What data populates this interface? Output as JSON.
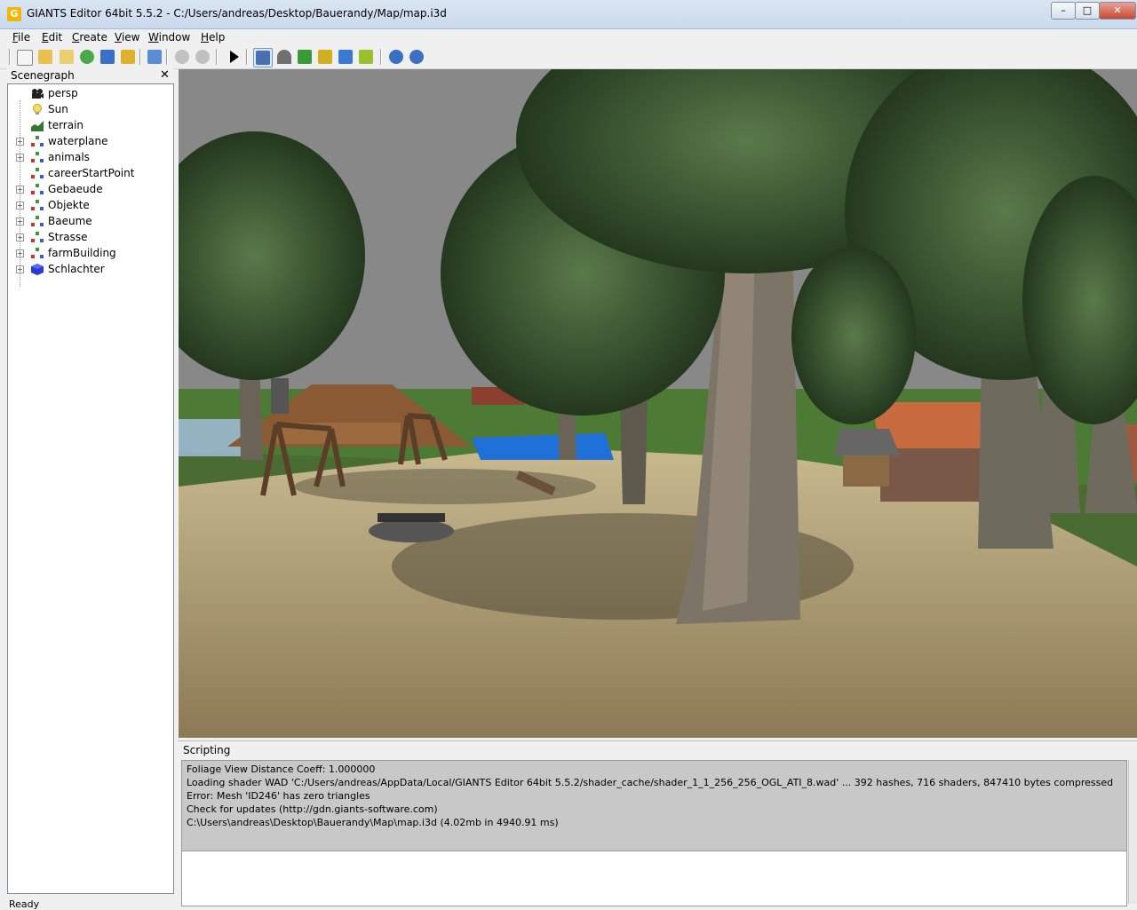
{
  "window": {
    "title": "GIANTS Editor 64bit 5.5.2 - C:/Users/andreas/Desktop/Bauerandy/Map/map.i3d",
    "app_icon_letter": "G",
    "minimize": "–",
    "maximize": "□",
    "close": "✕"
  },
  "menu": {
    "items": [
      {
        "label": "File"
      },
      {
        "label": "Edit"
      },
      {
        "label": "Create"
      },
      {
        "label": "View"
      },
      {
        "label": "Window"
      },
      {
        "label": "Help"
      }
    ]
  },
  "toolbar": {
    "buttons": [
      {
        "icon": "new-file-icon",
        "color": "#f5f5f5"
      },
      {
        "icon": "open-folder-icon",
        "color": "#e8c050"
      },
      {
        "icon": "edit-icon",
        "color": "#e8d070"
      },
      {
        "icon": "refresh-icon",
        "color": "#4aa84a"
      },
      {
        "icon": "save-icon",
        "color": "#3a6fc6"
      },
      {
        "icon": "save-as-icon",
        "color": "#e0b030"
      },
      {
        "icon": "import-icon",
        "color": "#5b8bd6"
      },
      {
        "icon": "undo-icon",
        "color": "#c0c0c0"
      },
      {
        "icon": "redo-icon",
        "color": "#c0c0c0"
      },
      {
        "icon": "play-icon",
        "color": "#000000"
      },
      {
        "icon": "home-camera-icon",
        "color": "#4a6fb0"
      },
      {
        "icon": "magnet-icon",
        "color": "#707070"
      },
      {
        "icon": "terrain-paint-icon",
        "color": "#3a9a3a"
      },
      {
        "icon": "foliage-paint-icon",
        "color": "#d0b020"
      },
      {
        "icon": "terrain-sculpt-icon",
        "color": "#3a7ad0"
      },
      {
        "icon": "foliage-icon",
        "color": "#9ac030"
      },
      {
        "icon": "settings-cycle-icon",
        "color": "#3a6fc6"
      },
      {
        "icon": "search-settings-icon",
        "color": "#3a6fc6"
      }
    ]
  },
  "scenegraph": {
    "title": "Scenegraph",
    "close": "✕",
    "items": [
      {
        "label": "persp",
        "icon": "camera-icon",
        "expandable": false
      },
      {
        "label": "Sun",
        "icon": "light-bulb-icon",
        "expandable": false
      },
      {
        "label": "terrain",
        "icon": "terrain-icon",
        "expandable": false
      },
      {
        "label": "waterplane",
        "icon": "transform-group-icon",
        "expandable": true
      },
      {
        "label": "animals",
        "icon": "transform-group-icon",
        "expandable": true
      },
      {
        "label": "careerStartPoint",
        "icon": "transform-group-icon",
        "expandable": false
      },
      {
        "label": "Gebaeude",
        "icon": "transform-group-icon",
        "expandable": true
      },
      {
        "label": "Objekte",
        "icon": "transform-group-icon",
        "expandable": true
      },
      {
        "label": "Baeume",
        "icon": "transform-group-icon",
        "expandable": true
      },
      {
        "label": "Strasse",
        "icon": "transform-group-icon",
        "expandable": true
      },
      {
        "label": "farmBuilding",
        "icon": "transform-group-icon",
        "expandable": true
      },
      {
        "label": "Schlachter",
        "icon": "shape-cube-icon",
        "expandable": true
      }
    ]
  },
  "scripting": {
    "title": "Scripting",
    "log": [
      "  Foliage View Distance Coeff: 1.000000",
      "Loading shader WAD 'C:/Users/andreas/AppData/Local/GIANTS Editor 64bit 5.5.2/shader_cache/shader_1_1_256_256_OGL_ATI_8.wad' ... 392 hashes, 716 shaders, 847410 bytes compressed",
      "Error: Mesh 'ID246' has zero triangles",
      "Check for updates (http://gdn.giants-software.com)",
      "C:\\Users\\andreas\\Desktop\\Bauerandy\\Map\\map.i3d (4.02mb in 4940.91 ms)"
    ],
    "input_value": ""
  },
  "status": {
    "text": "Ready"
  }
}
